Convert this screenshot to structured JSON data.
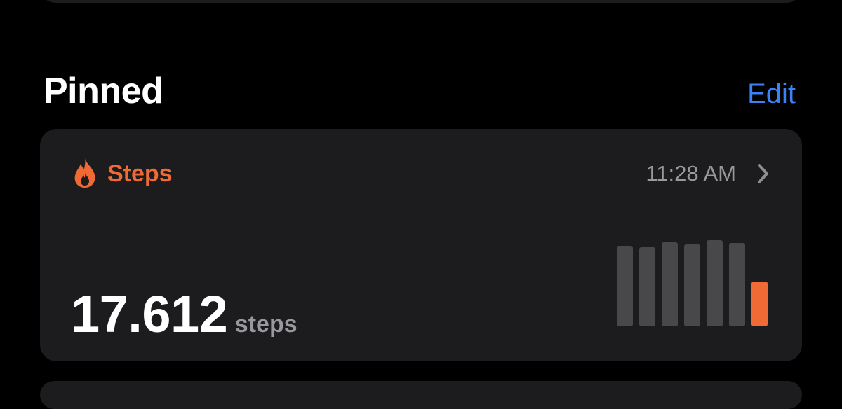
{
  "section": {
    "title": "Pinned",
    "edit_label": "Edit"
  },
  "card": {
    "metric_label": "Steps",
    "time": "11:28 AM",
    "value": "17.612",
    "unit": "steps",
    "icons": {
      "metric": "flame-icon",
      "disclosure": "chevron-right-icon"
    },
    "colors": {
      "accent": "#ef6a35",
      "bar_inactive": "#48484a",
      "edit_blue": "#3b82f6"
    },
    "bars": [
      {
        "level": 0.93,
        "highlight": false
      },
      {
        "level": 0.91,
        "highlight": false
      },
      {
        "level": 0.97,
        "highlight": false
      },
      {
        "level": 0.94,
        "highlight": false
      },
      {
        "level": 0.99,
        "highlight": false
      },
      {
        "level": 0.96,
        "highlight": false
      },
      {
        "level": 0.52,
        "highlight": true
      }
    ]
  }
}
